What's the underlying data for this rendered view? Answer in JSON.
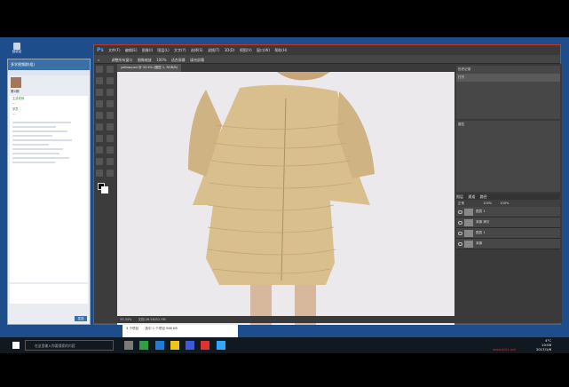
{
  "titlebar": {
    "mark": "● ● ● ● ●"
  },
  "desktop_icon": {
    "label": "回收站"
  },
  "chat": {
    "title": "多学视频群(组)",
    "members_online": "资源模板",
    "group_name": "第2期",
    "messages": [
      {
        "who": "主讲老师",
        "text": "…"
      },
      {
        "who": "学员",
        "text": "…"
      }
    ],
    "input_placeholder": "",
    "send_label": "发送"
  },
  "photoshop": {
    "logo": "Ps",
    "menus": [
      "文件(F)",
      "编辑(E)",
      "图像(I)",
      "图层(L)",
      "文字(Y)",
      "选择(S)",
      "滤镜(T)",
      "3D(D)",
      "视图(V)",
      "窗口(W)",
      "帮助(H)"
    ],
    "options": [
      "调整所有窗口",
      "细微缩放",
      "100%",
      "适合屏幕",
      "填充屏幕"
    ],
    "doc_tab": "yellow.psd @ 33.4% (图层 1, RGB/8)",
    "status_zoom": "33.34%",
    "status_doc": "文档:26.5M/52.9M",
    "panels": {
      "history_title": "历史记录",
      "history_item": "打开",
      "props_title": "属性",
      "layers_tabs": [
        "图层",
        "通道",
        "路径"
      ],
      "blend": "正常",
      "opacity": "100%",
      "fill": "100%",
      "layers": [
        {
          "name": "图层 1"
        },
        {
          "name": "背景 拷贝"
        },
        {
          "name": "图层 1"
        },
        {
          "name": "背景"
        }
      ]
    }
  },
  "explorer": {
    "count": "3 个项目",
    "selection": "选中 1 个项目 568 KB"
  },
  "taskbar": {
    "search_placeholder": "在这里输入你要搜索的内容",
    "time": "10:06",
    "date": "2017/1/6",
    "temp": "4°C",
    "watermark": "www.jb51.net"
  },
  "colors": {
    "accent": "#c0392b",
    "ps_bg": "#535353",
    "canvas": "#ece9ec",
    "coat": "#d9bf8e"
  }
}
